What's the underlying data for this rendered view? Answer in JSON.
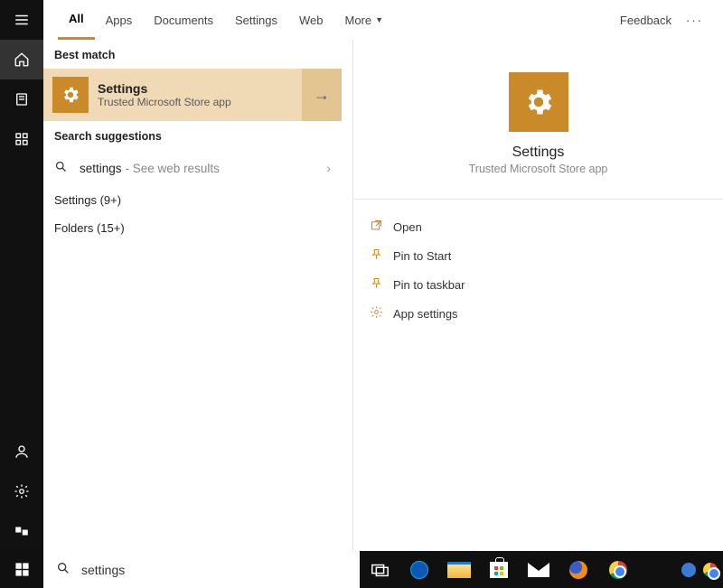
{
  "top": {
    "tabs": [
      "All",
      "Apps",
      "Documents",
      "Settings",
      "Web",
      "More"
    ],
    "feedback": "Feedback",
    "dots": "···"
  },
  "results": {
    "bestMatchHeader": "Best match",
    "bestMatch": {
      "title": "Settings",
      "subtitle": "Trusted Microsoft Store app"
    },
    "suggHeader": "Search suggestions",
    "webSuggestion": {
      "query": "settings",
      "tail": " - See web results"
    },
    "catSettings": "Settings (9+)",
    "catFolders": "Folders (15+)"
  },
  "preview": {
    "title": "Settings",
    "subtitle": "Trusted Microsoft Store app",
    "actions": {
      "open": "Open",
      "pinStart": "Pin to Start",
      "pinTaskbar": "Pin to taskbar",
      "appSettings": "App settings"
    }
  },
  "search": {
    "value": "settings"
  }
}
